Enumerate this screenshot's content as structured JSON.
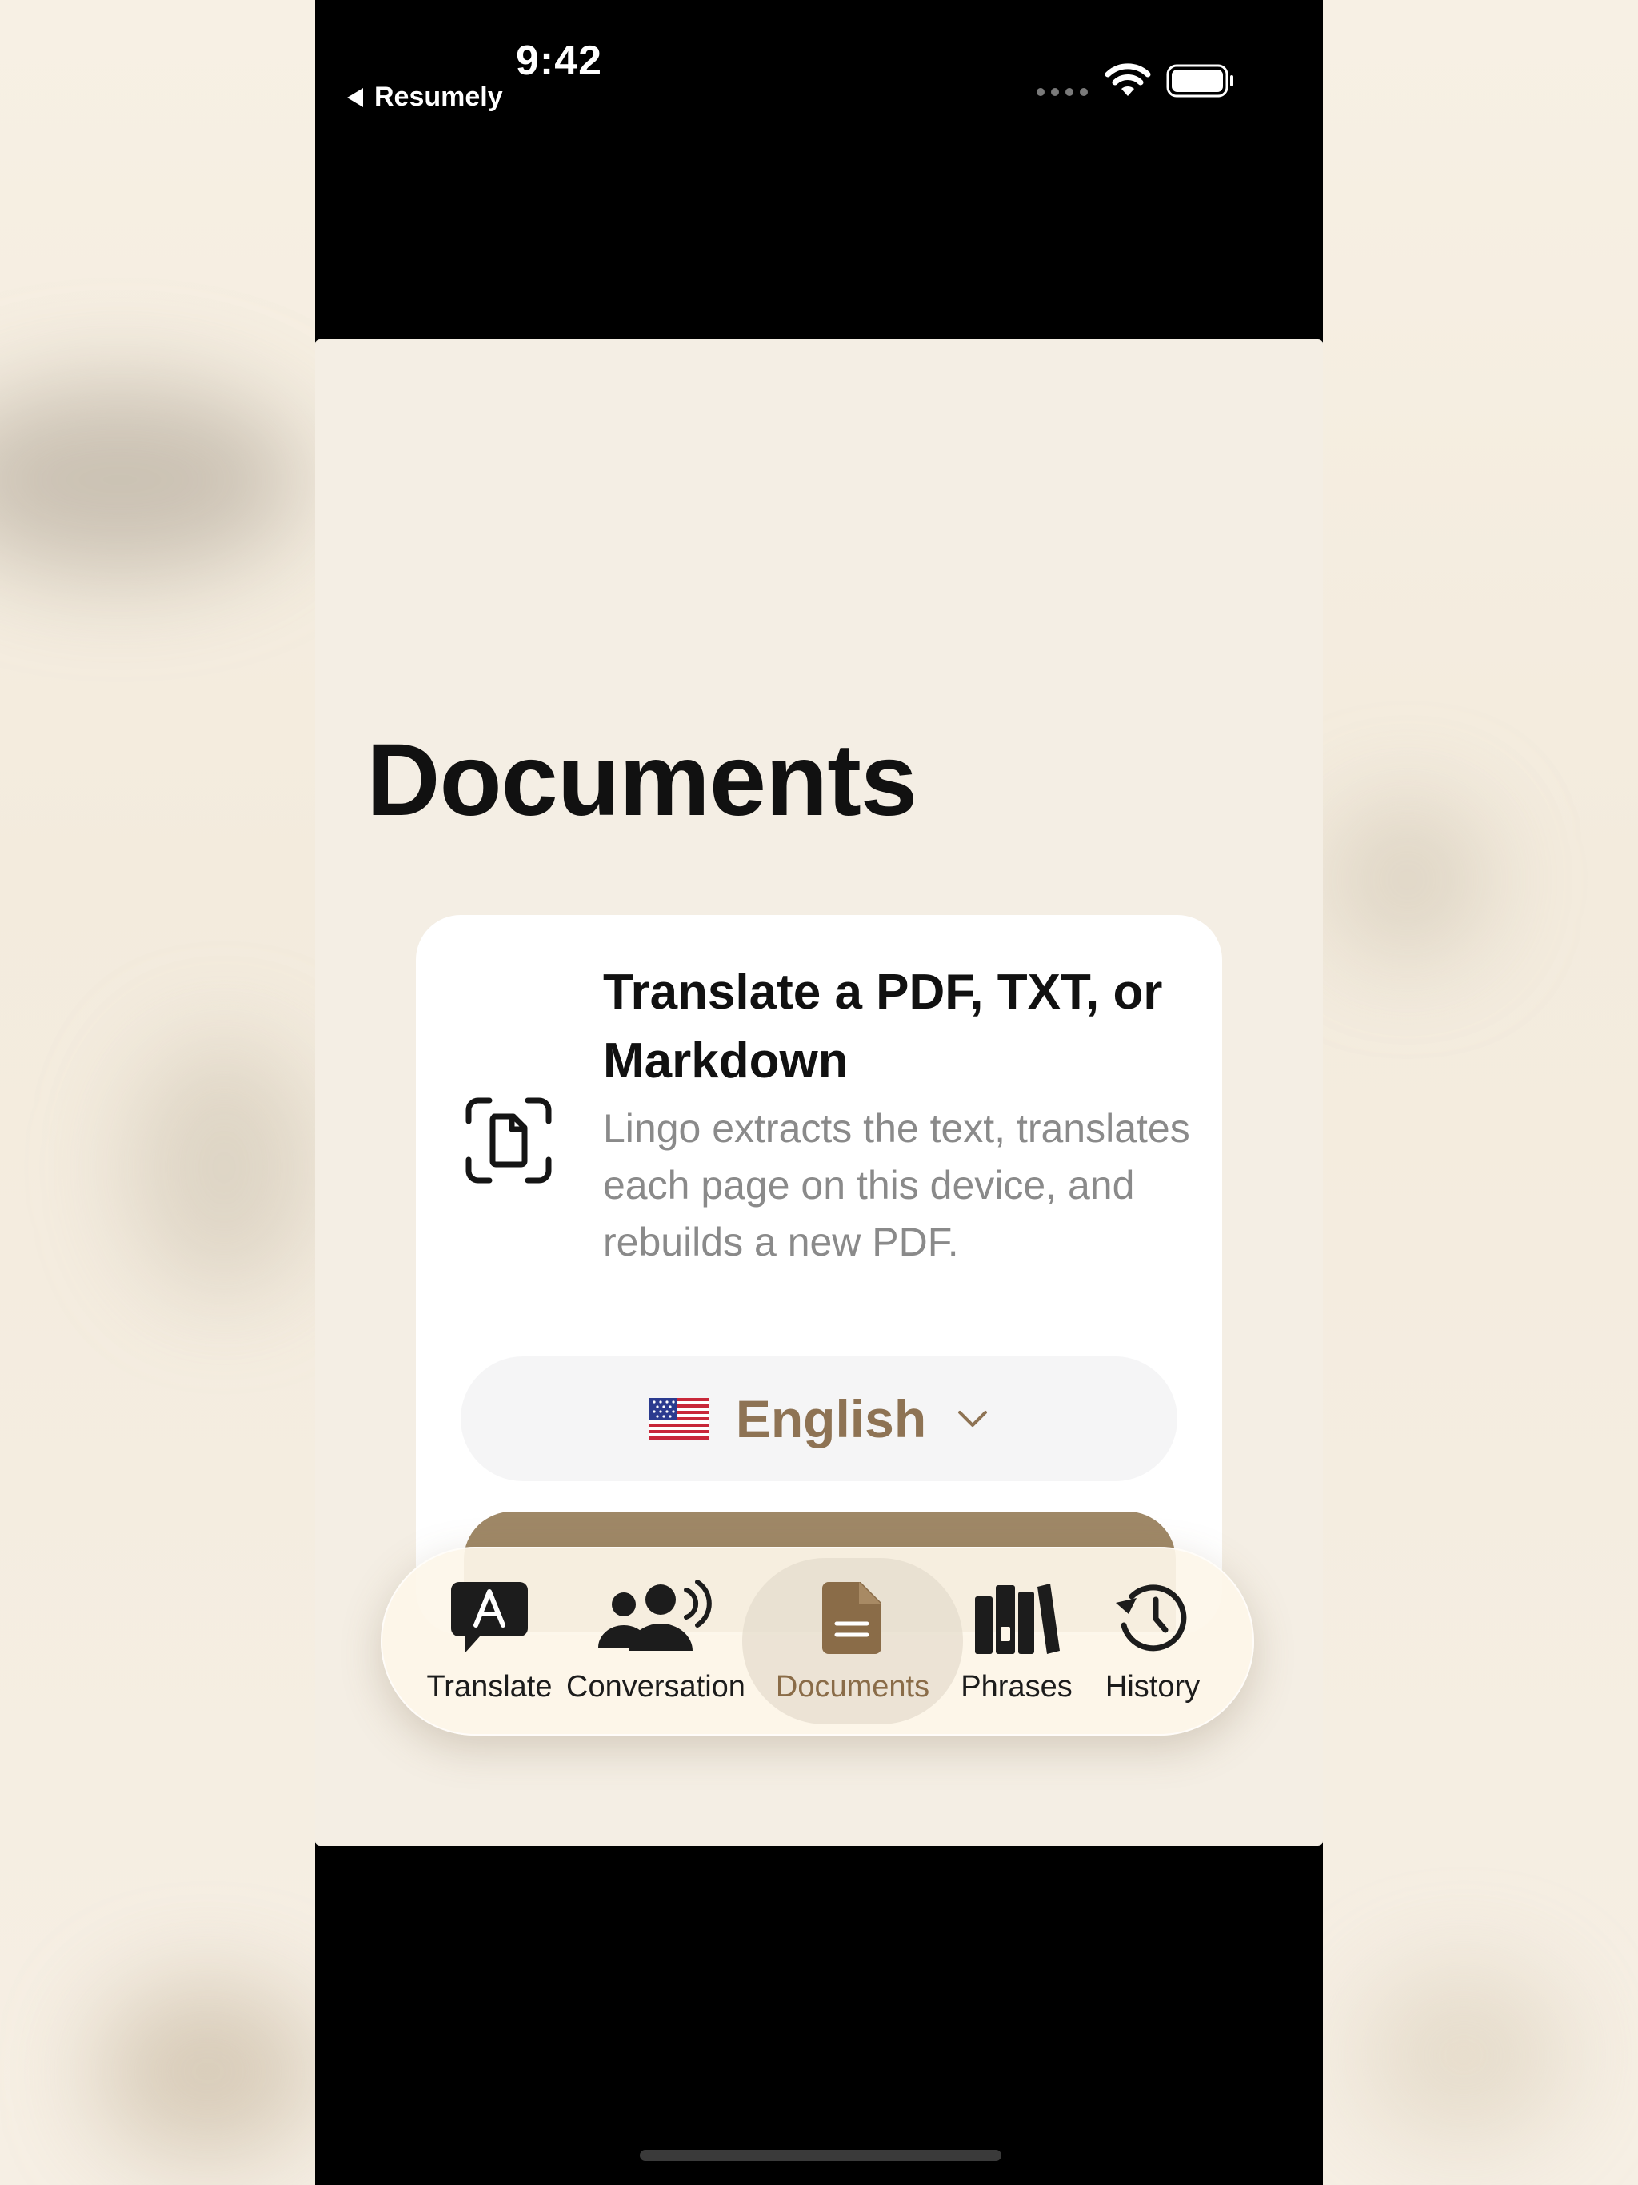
{
  "status_bar": {
    "time": "9:42",
    "back_app": "Resumely"
  },
  "page": {
    "title": "Documents"
  },
  "card": {
    "icon": "document-scan-icon",
    "title": "Translate a PDF, TXT, or Markdown",
    "description": "Lingo extracts the text, translates each page on this device, and rebuilds a new PDF.",
    "language": {
      "flag": "us-flag-icon",
      "label": "English"
    }
  },
  "tabs": [
    {
      "label": "Translate",
      "icon": "translate-bubble-icon",
      "active": false
    },
    {
      "label": "Conversation",
      "icon": "conversation-people-icon",
      "active": false
    },
    {
      "label": "Documents",
      "icon": "document-icon",
      "active": true
    },
    {
      "label": "Phrases",
      "icon": "books-icon",
      "active": false
    },
    {
      "label": "History",
      "icon": "history-clock-icon",
      "active": false
    }
  ],
  "colors": {
    "accent": "#8e7354",
    "screen_bg": "#f4eee4",
    "button": "#9f8867"
  }
}
